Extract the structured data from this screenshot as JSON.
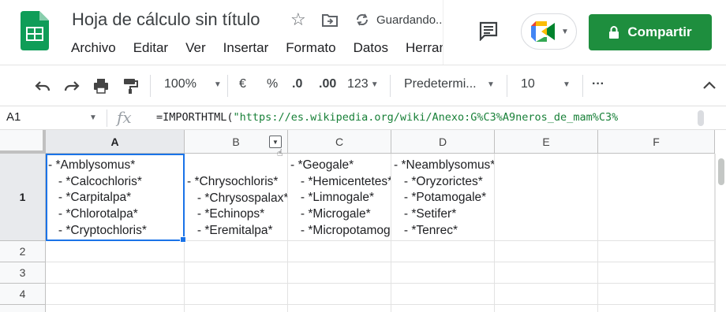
{
  "app": {
    "doc_title": "Hoja de cálculo sin título",
    "saving_status": "Guardando...",
    "menu": [
      "Archivo",
      "Editar",
      "Ver",
      "Insertar",
      "Formato",
      "Datos",
      "Herramientas"
    ],
    "share_label": "Compartir"
  },
  "toolbar": {
    "zoom": "100%",
    "currency": "€",
    "percent": "%",
    "dec_decrease": ".0",
    "dec_increase": ".00",
    "more_formats": "123",
    "font": "Predetermi...",
    "font_size": "10",
    "more": "···"
  },
  "formula_bar": {
    "cell_ref": "A1",
    "fx": "fx",
    "formula_fn": "=IMPORTHTML(",
    "formula_str": "\"https://es.wikipedia.org/wiki/Anexo:G%C3%A9neros_de_mam%C3%"
  },
  "grid": {
    "columns": [
      "A",
      "B",
      "C",
      "D",
      "E",
      "F"
    ],
    "rows": [
      "1",
      "2",
      "3",
      "4"
    ],
    "cells": {
      "A1": "- *Amblysomus*\n   - *Calcochloris*\n   - *Carpitalpa*\n   - *Chlorotalpa*\n   - *Cryptochloris*",
      "B1": "- *Chrysochloris*\n   - *Chrysospalax*\n   - *Echinops*\n   - *Eremitalpa*",
      "C1": "- *Geogale*\n   - *Hemicentetes*\n   - *Limnogale*\n   - *Microgale*\n   - *Micropotamogale*",
      "D1": "- *Neamblysomus*\n   - *Oryzorictes*\n   - *Potamogale*\n   - *Setifer*\n   - *Tenrec*"
    }
  },
  "colors": {
    "share_green": "#1e8e3e",
    "selection_blue": "#1a73e8",
    "sheets_green": "#0f9d58",
    "string_green": "#188038"
  }
}
